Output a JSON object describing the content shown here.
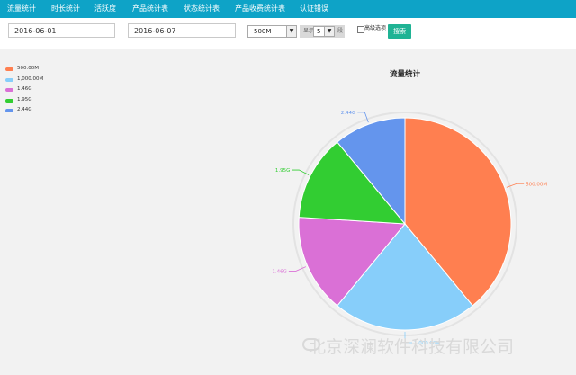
{
  "nav": {
    "tabs": [
      "流量统计",
      "时长统计",
      "活跃度",
      "产品统计表",
      "状态统计表",
      "产品收费统计表",
      "认证错误"
    ]
  },
  "filters": {
    "start_date": "2016-06-01",
    "end_date": "2016-06-07",
    "size_select": "500M",
    "show_prefix": "显示",
    "show_count": "5",
    "show_suffix": "段",
    "checkbox_label": "高级选项",
    "search_label": "搜索"
  },
  "chart_data": {
    "type": "pie",
    "title": "流量统计",
    "categories": [
      "500.00M",
      "1,000.00M",
      "1.46G",
      "1.95G",
      "2.44G"
    ],
    "values": [
      39,
      22,
      15,
      13,
      11
    ],
    "colors": [
      "#ff7f50",
      "#87cefa",
      "#da70d6",
      "#32cd32",
      "#6495ed"
    ],
    "legend_position": "top-left"
  },
  "watermark": {
    "text": "北京深澜软件科技有限公司"
  }
}
